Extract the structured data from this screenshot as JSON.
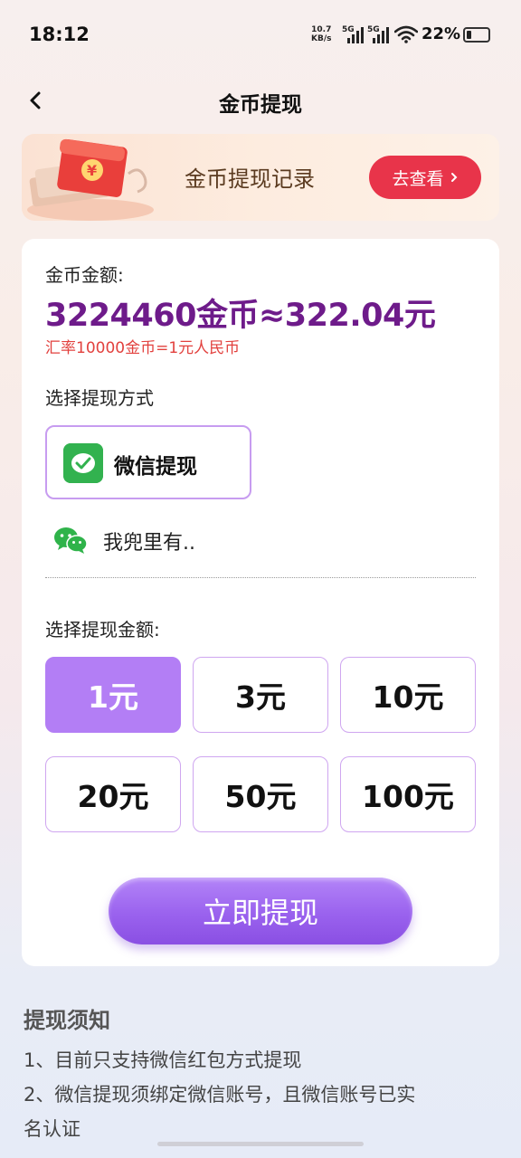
{
  "status_bar": {
    "time": "18:12",
    "net_speed_value": "10.7",
    "net_speed_unit": "KB/s",
    "sim1": "5G",
    "sim2": "5G",
    "battery_pct": "22%",
    "battery_level": 0.22
  },
  "header": {
    "title": "金币提现",
    "back_icon": "chevron-left-icon"
  },
  "banner": {
    "title": "金币提现记录",
    "button_label": "去查看"
  },
  "balance": {
    "label": "金币金额:",
    "value": "3224460金币≈322.04元",
    "rate": "汇率10000金币=1元人民币"
  },
  "method": {
    "label": "选择提现方式",
    "option_label": "微信提现",
    "account_name": "我兜里有.."
  },
  "amounts": {
    "label": "选择提现金额:",
    "options": [
      "1元",
      "3元",
      "10元",
      "20元",
      "50元",
      "100元"
    ],
    "selected_index": 0
  },
  "submit_label": "立即提现",
  "notice": {
    "title": "提现须知",
    "items": [
      "1、目前只支持微信红包方式提现",
      "2、微信提现须绑定微信账号，且微信账号已实",
      "名认证"
    ]
  },
  "colors": {
    "accent": "#b37ef5",
    "amount_text": "#6e1b8a",
    "rate_text": "#e2413e",
    "banner_button": "#e8344a",
    "wechat_green": "#32b24f"
  }
}
